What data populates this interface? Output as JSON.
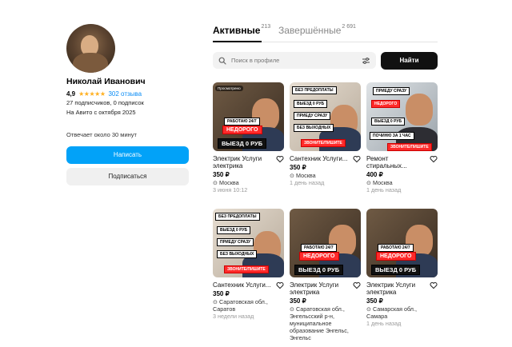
{
  "profile": {
    "name": "Николай Иванович",
    "rating": "4,9",
    "stars": "★★★★★",
    "reviews": "302 отзыва",
    "subscribers": "27 подписчиков, 0 подписок",
    "since": "На Авито с октября 2025",
    "reply_time": "Отвечает около 30 минут",
    "write_label": "Написать",
    "subscribe_label": "Подписаться"
  },
  "tabs": {
    "active_label": "Активные",
    "active_count": "213",
    "done_label": "Завершённые",
    "done_count": "2 691"
  },
  "search": {
    "placeholder": "Поиск в профиле",
    "button_label": "Найти"
  },
  "colors": {
    "accent": "#02a2f8",
    "star": "#ffb021",
    "link": "#0a8cf5"
  },
  "listings": [
    {
      "title": "Электрик Услуги электрика",
      "price": "350 ₽",
      "location": "Москва",
      "date": "3 июня 10:12",
      "tag": "Просмотрено",
      "labels": [
        "РАБОТАЮ 24/7",
        "НЕДОРОГО",
        "ВЫЕЗД 0 РУБ"
      ]
    },
    {
      "title": "Сантехник Услуги...",
      "price": "350 ₽",
      "location": "Москва",
      "date": "1 день назад",
      "labels": [
        "БЕЗ ПРЕДОПЛАТЫ",
        "ВЫЕЗД 0 РУБ",
        "ПРИЕДУ СРАЗУ",
        "БЕЗ ВЫХОДНЫХ",
        "ЗВОНИТЕ/ПИШИТЕ"
      ]
    },
    {
      "title": "Ремонт стиральных...",
      "price": "400 ₽",
      "location": "Москва",
      "date": "1 день назад",
      "labels": [
        "ПРИЕДУ СРАЗУ",
        "НЕДОРОГО",
        "ВЫЕЗД 0 РУБ",
        "ПОЧИНЮ ЗА 1 ЧАС",
        "ЗВОНИТЕ/ПИШИТЕ"
      ]
    },
    {
      "title": "Сантехник Услуги...",
      "price": "350 ₽",
      "location": "Саратовская обл., Саратов",
      "date": "3 недели назад",
      "labels": [
        "БЕЗ ПРЕДОПЛАТЫ",
        "ВЫЕЗД 0 РУБ",
        "ПРИЕДУ СРАЗУ",
        "БЕЗ ВЫХОДНЫХ",
        "ЗВОНИТЕ/ПИШИТЕ"
      ]
    },
    {
      "title": "Электрик Услуги электрика",
      "price": "350 ₽",
      "location": "Саратовская обл., Энгельсский р-н, муниципальное образование Энгельс, Энгельс",
      "date": "",
      "labels": [
        "РАБОТАЮ 24/7",
        "НЕДОРОГО",
        "ВЫЕЗД 0 РУБ"
      ]
    },
    {
      "title": "Электрик Услуги электрика",
      "price": "350 ₽",
      "location": "Самарская обл., Самара",
      "date": "1 день назад",
      "labels": [
        "РАБОТАЮ 24/7",
        "НЕДОРОГО",
        "ВЫЕЗД 0 РУБ"
      ]
    }
  ]
}
